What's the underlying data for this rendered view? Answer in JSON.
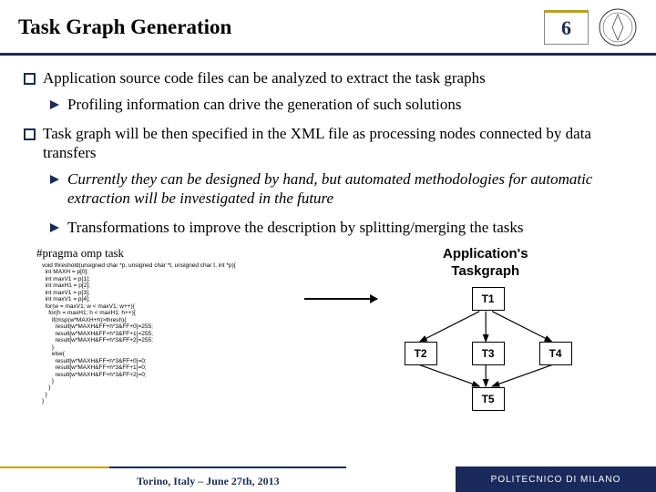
{
  "header": {
    "title": "Task Graph Generation",
    "page_number": "6"
  },
  "bullets": {
    "b1": "Application source code files can be analyzed to extract the task graphs",
    "b1_sub": "Profiling information can drive the generation of such solutions",
    "b2": "Task graph will be then specified in the XML file as processing nodes connected by data transfers",
    "b2_sub1": "Currently they can be designed by hand, but automated methodologies for automatic extraction will be investigated in the future",
    "b2_sub2": "Transformations to improve the description by splitting/merging the tasks"
  },
  "code": {
    "pragma": "#pragma omp task",
    "body": "void threshold(unsigned char *p, unsigned char *t, unsigned char t, int *p){\n  int MAXH = p[0];\n  int maxV1 = p[1];\n  int maxH1 = p[2];\n  int maxV1 = p[3];\n  int maxV1 = p[4];\n  for(w = maxV1; w < maxV1; w++){\n    for(h = maxH1; h < maxH1; h++){\n      if(msp(w*MAXH+h)>thresh){\n        result[w*MAXH&FF+h*3&FF+0]=255;\n        result[w*MAXH&FF+h*3&FF+1]=255;\n        result[w*MAXH&FF+h*3&FF+2]=255;\n      }\n      else{\n        result[w*MAXH&FF+h*3&FF+0]=0;\n        result[w*MAXH&FF+h*3&FF+1]=0;\n        result[w*MAXH&FF+h*3&FF+2]=0;\n      }\n    }\n  }\n}"
  },
  "graph": {
    "title": "Application's\nTaskgraph",
    "nodes": {
      "n1": "T1",
      "n2": "T2",
      "n3": "T3",
      "n4": "T4",
      "n5": "T5"
    }
  },
  "footer": {
    "venue": "Torino, Italy – June 27th, 2013",
    "institution": "POLITECNICO DI MILANO"
  }
}
